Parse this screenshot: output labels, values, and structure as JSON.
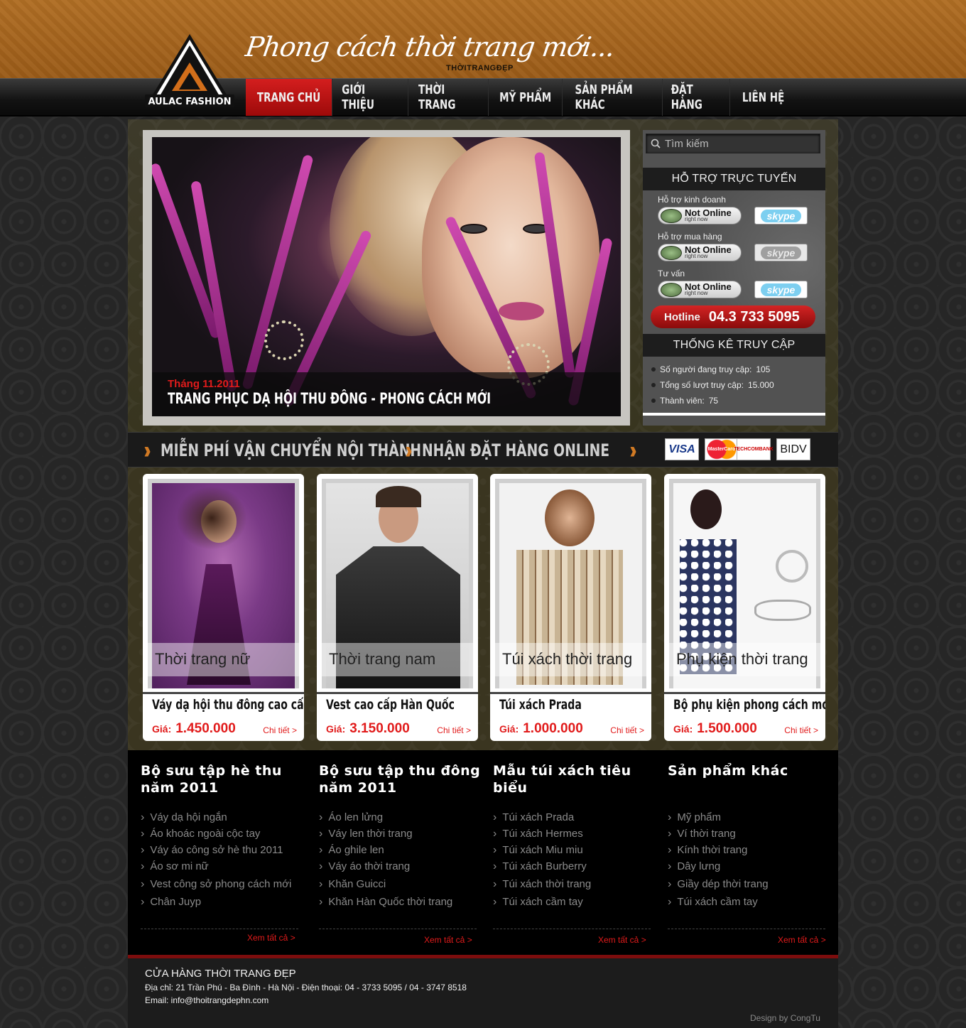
{
  "header": {
    "slogan": "Phong cách thời trang mới...",
    "slogan_sub": "THỜITRANGĐẸP",
    "logo_text": "AULAC FASHION"
  },
  "nav": {
    "items": [
      "TRANG CHỦ",
      "GIỚI THIỆU",
      "THỜI TRANG",
      "MỸ PHẨM",
      "SẢN PHẨM KHÁC",
      "ĐẶT HÀNG",
      "LIÊN HỆ"
    ],
    "active": "TRANG CHỦ"
  },
  "slider": {
    "date": "Tháng 11.2011",
    "title": "TRANG PHỤC DẠ HỘI THU ĐÔNG - PHONG CÁCH MỚI"
  },
  "sidebar": {
    "search_placeholder": "Tìm kiếm",
    "support_title": "HỖ TRỢ TRỰC TUYẾN",
    "support": [
      {
        "label": "Hỗ trợ kinh doanh",
        "status": "Not Online",
        "status_sub": "right now",
        "skype": "skype"
      },
      {
        "label": "Hỗ trợ mua hàng",
        "status": "Not Online",
        "status_sub": "right now",
        "skype": "skype"
      },
      {
        "label": "Tư vấn",
        "status": "Not Online",
        "status_sub": "right now",
        "skype": "skype"
      }
    ],
    "hotline_label": "Hotline",
    "hotline_number": "04.3 733 5095",
    "stats_title": "THỐNG KÊ TRUY CẬP",
    "stats": [
      {
        "label": "Số người đang truy cập:",
        "value": "105"
      },
      {
        "label": "Tổng số lượt truy cập:",
        "value": "15.000"
      },
      {
        "label": "Thành viên:",
        "value": "75"
      }
    ]
  },
  "banner": {
    "item1": "MIỄN PHÍ VẬN CHUYỂN NỘI THÀNH",
    "item2": "NHẬN ĐẶT HÀNG ONLINE",
    "payments": [
      "VISA",
      "MasterCard",
      "TECHCOMBANK",
      "BIDV"
    ]
  },
  "products": [
    {
      "category": "Thời trang nữ",
      "name": "Váy dạ hội thu đông cao cấp",
      "price_label": "Giá:",
      "price": "1.450.000",
      "more": "Chi tiết >"
    },
    {
      "category": "Thời trang nam",
      "name": "Vest cao cấp Hàn Quốc",
      "price_label": "Giá:",
      "price": "3.150.000",
      "more": "Chi tiết >"
    },
    {
      "category": "Túi xách thời trang",
      "name": "Túi xách Prada",
      "price_label": "Giá:",
      "price": "1.000.000",
      "more": "Chi tiết >"
    },
    {
      "category": "Phụ kiện thời trang",
      "name": "Bộ phụ kiện phong cách mới",
      "price_label": "Giá:",
      "price": "1.500.000",
      "more": "Chi tiết >"
    }
  ],
  "link_columns": [
    {
      "title": "Bộ sưu tập hè thu năm 2011",
      "items": [
        "Váy dạ hội ngắn",
        "Áo khoác ngoài cộc tay",
        "Váy áo công sở hè thu 2011",
        "Áo sơ mi nữ",
        "Vest công sở phong cách mới",
        "Chân Juyp"
      ],
      "more": "Xem tất cả >"
    },
    {
      "title": "Bộ sưu tập thu đông năm 2011",
      "items": [
        "Áo len lửng",
        "Váy len thời trang",
        "Áo ghile len",
        "Váy áo thời trang",
        "Khăn Guicci",
        "Khăn Hàn Quốc thời trang"
      ],
      "more": "Xem tất cả >"
    },
    {
      "title": "Mẫu túi xách tiêu biểu",
      "items": [
        "Túi xách Prada",
        "Túi xách Hermes",
        "Túi xách Miu miu",
        "Túi xách Burberry",
        "Túi xách thời trang",
        "Túi xách cầm tay"
      ],
      "more": "Xem tất cả >"
    },
    {
      "title": "Sản phẩm khác",
      "items": [
        "Mỹ phẩm",
        "Ví thời trang",
        "Kính thời trang",
        "Dây lưng",
        "Giầy dép thời trang",
        "Túi xách cầm tay"
      ],
      "more": "Xem tất cả >"
    }
  ],
  "footer": {
    "title": "CỬA HÀNG THỜI TRANG ĐẸP",
    "address": "Địa chỉ: 21 Trần Phú - Ba Đình - Hà Nội - Điện thoại: 04 - 3733 5095 / 04 - 3747 8518",
    "email": "Email: info@thoitrangdephn.com",
    "design": "Design by CongTu"
  },
  "colors": {
    "accent_red": "#e11b1b",
    "header_brown": "#a8651e",
    "nav_active": "#c41414"
  }
}
